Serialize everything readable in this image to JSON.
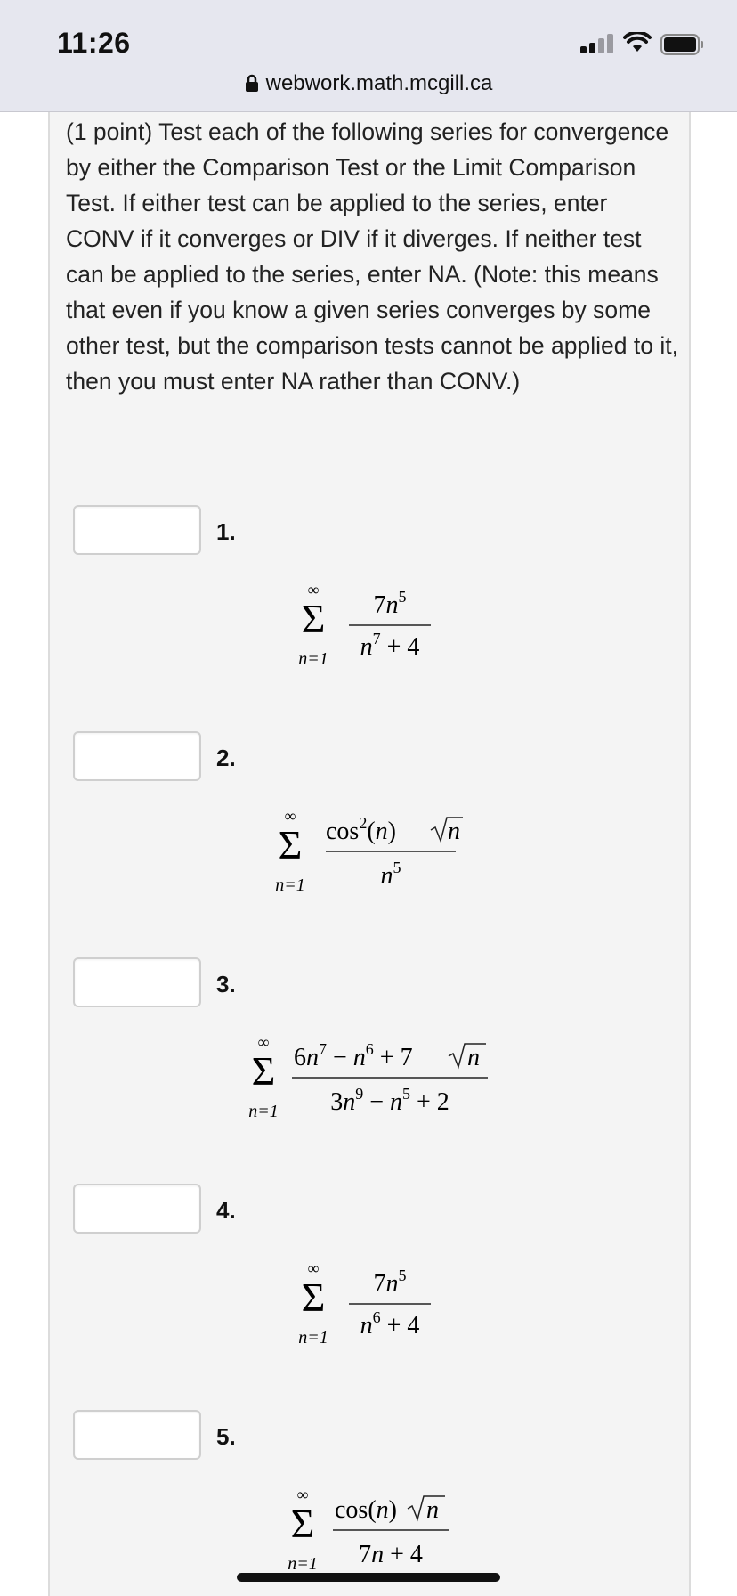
{
  "status_bar": {
    "time": "11:26"
  },
  "browser": {
    "url": "webwork.math.mcgill.ca"
  },
  "problem": {
    "intro": "(1 point) Test each of the following series for convergence by either the Comparison Test or the Limit Comparison Test. If either test can be applied to the series, enter CONV if it converges or DIV if it diverges. If neither test can be applied to the series, enter NA. (Note: this means that even if you know a given series converges by some other test, but the comparison tests cannot be applied to it, then you must enter NA rather than CONV.)",
    "items": [
      {
        "number": "1.",
        "answer": "",
        "sum_upper": "∞",
        "sum_lower": "n=1"
      },
      {
        "number": "2.",
        "answer": "",
        "sum_upper": "∞",
        "sum_lower": "n=1"
      },
      {
        "number": "3.",
        "answer": "",
        "sum_upper": "∞",
        "sum_lower": "n=1"
      },
      {
        "number": "4.",
        "answer": "",
        "sum_upper": "∞",
        "sum_lower": "n=1"
      },
      {
        "number": "5.",
        "answer": "",
        "sum_upper": "∞",
        "sum_lower": "n=1"
      }
    ]
  }
}
